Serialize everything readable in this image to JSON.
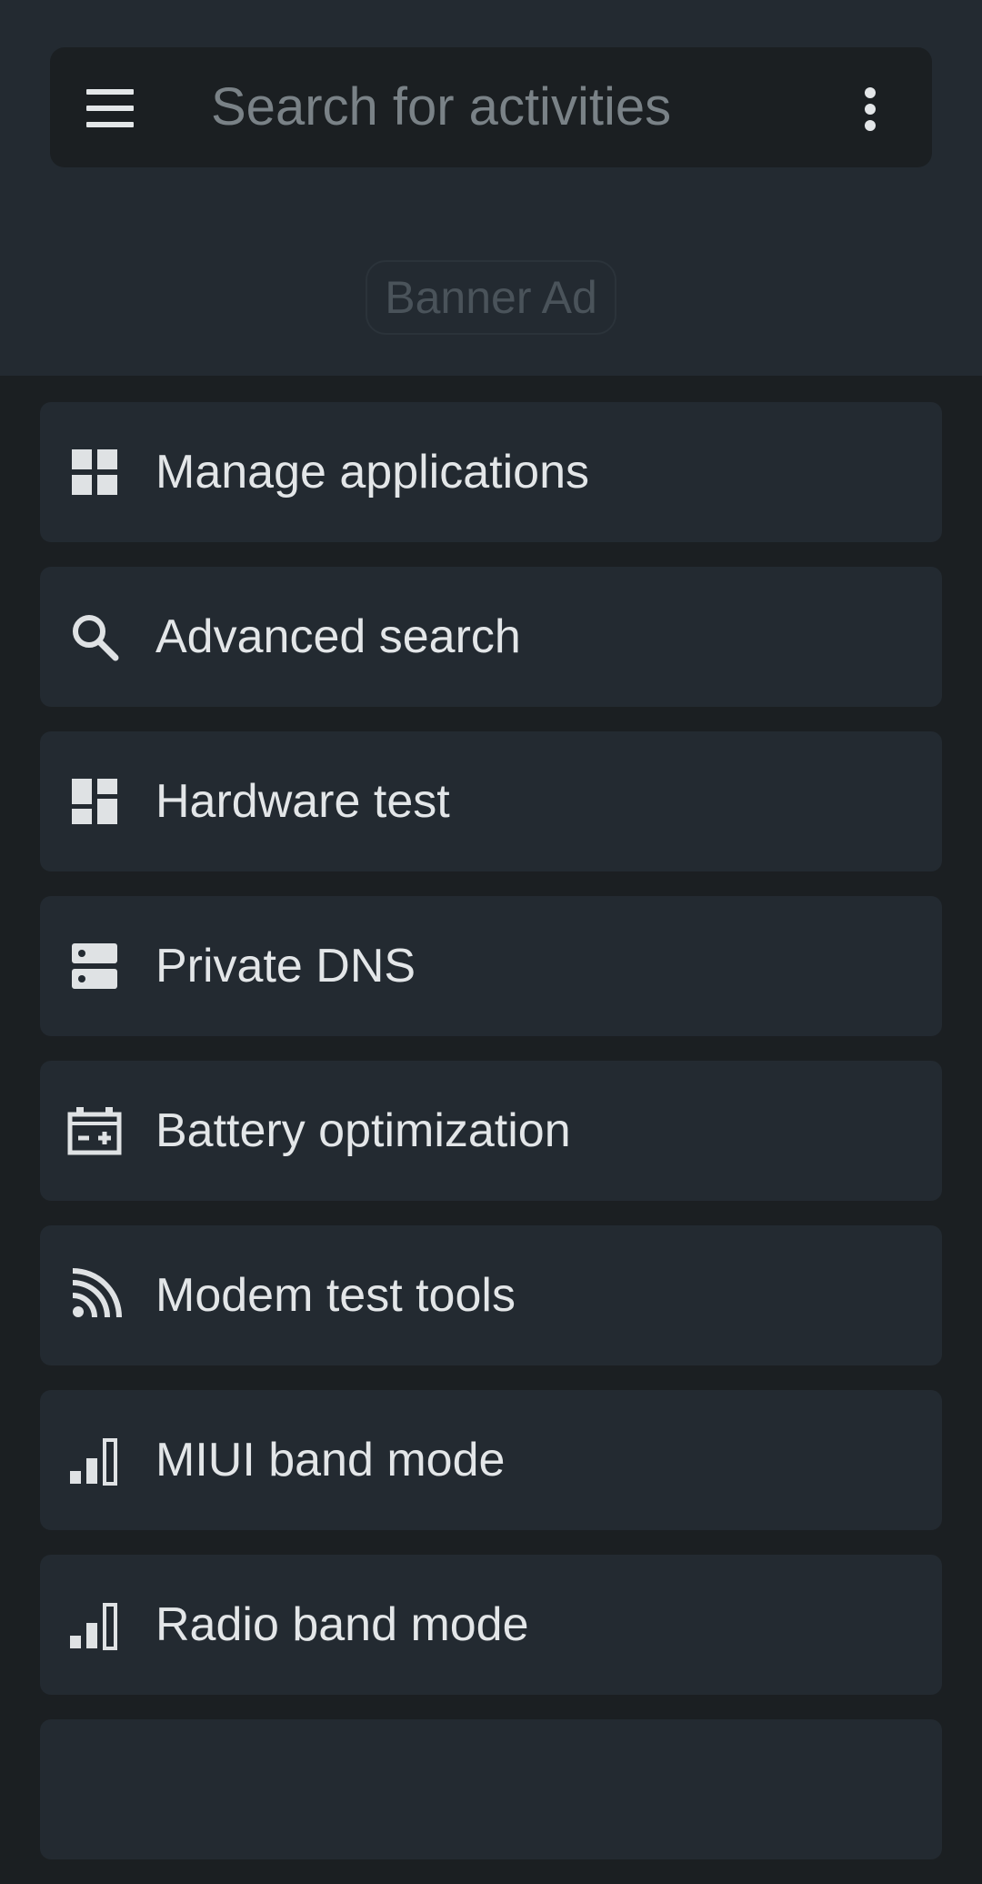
{
  "search": {
    "placeholder": "Search for activities",
    "menu_icon": "menu-icon",
    "overflow_icon": "more-vert-icon"
  },
  "banner": {
    "label": "Banner Ad"
  },
  "colors": {
    "background": "#1b1f22",
    "surface": "#232a31",
    "text": "#e3e6e8",
    "placeholder": "#7a8287"
  },
  "items": [
    {
      "label": "Manage applications",
      "icon": "apps-grid-icon"
    },
    {
      "label": "Advanced search",
      "icon": "search-icon"
    },
    {
      "label": "Hardware test",
      "icon": "dashboard-icon"
    },
    {
      "label": "Private DNS",
      "icon": "dns-server-icon"
    },
    {
      "label": "Battery optimization",
      "icon": "battery-plus-icon"
    },
    {
      "label": "Modem test tools",
      "icon": "rss-feed-icon"
    },
    {
      "label": "MIUI band mode",
      "icon": "signal-bars-icon"
    },
    {
      "label": "Radio band mode",
      "icon": "signal-bars-icon"
    }
  ]
}
